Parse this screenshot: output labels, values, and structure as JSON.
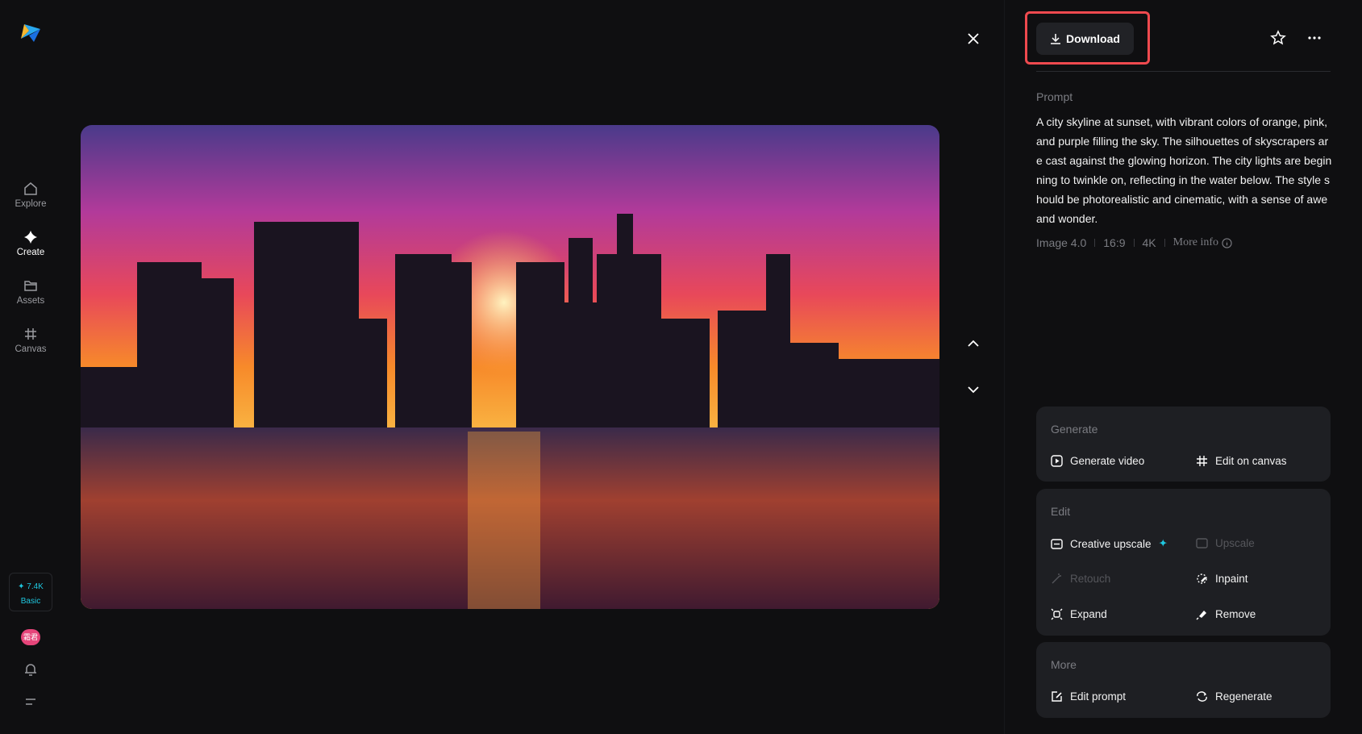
{
  "sidebar": {
    "items": [
      {
        "label": "Explore"
      },
      {
        "label": "Create"
      },
      {
        "label": "Assets"
      },
      {
        "label": "Canvas"
      }
    ],
    "credits": {
      "amount": "✦ 7.4K",
      "plan": "Basic"
    },
    "avatar": "霜君"
  },
  "toolbar": {
    "download_label": "Download"
  },
  "prompt": {
    "label": "Prompt",
    "text": "A city skyline at sunset, with vibrant colors of orange, pink, and purple filling the sky. The silhouettes of skyscrapers are cast against the glowing horizon. The city lights are beginning to twinkle on, reflecting in the water below. The style should be photorealistic and cinematic, with a sense of awe and wonder.",
    "meta": {
      "model": "Image 4.0",
      "ratio": "16:9",
      "resolution": "4K",
      "more_info": "More info"
    }
  },
  "generate": {
    "title": "Generate",
    "items": [
      "Generate video",
      "Edit on canvas"
    ]
  },
  "edit": {
    "title": "Edit",
    "items": [
      "Creative upscale",
      "Upscale",
      "Retouch",
      "Inpaint",
      "Expand",
      "Remove"
    ]
  },
  "more": {
    "title": "More",
    "items": [
      "Edit prompt",
      "Regenerate"
    ]
  },
  "colors": {
    "accent": "#1fc8e0",
    "highlight": "#ef4a4f"
  }
}
